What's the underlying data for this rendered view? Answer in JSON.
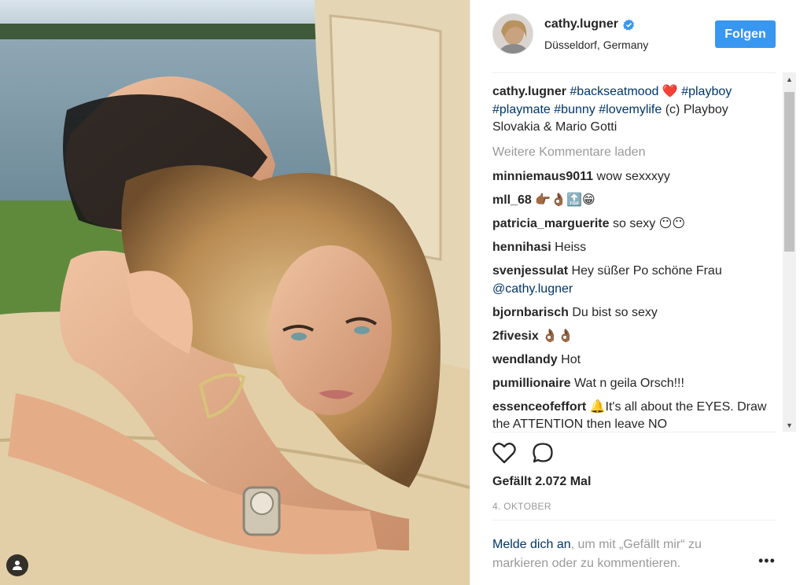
{
  "post": {
    "username": "cathy.lugner",
    "location": "Düsseldorf, Germany",
    "follow_label": "Folgen",
    "caption": {
      "user": "cathy.lugner",
      "tag1": "#backseatmood",
      "heart": "❤️",
      "tag2": "#playboy",
      "tag3": "#playmate",
      "tag4": "#bunny",
      "tag5": "#lovemylife",
      "rest": " (c) Playboy Slovakia & Mario Gotti"
    },
    "load_more": "Weitere Kommentare laden",
    "comments": [
      {
        "user": "minniemaus9011",
        "text": "wow sexxxyy"
      },
      {
        "user": "mll_68",
        "text": "👉🏾👌🏾🔝😁"
      },
      {
        "user": "patricia_marguerite",
        "text": "so sexy 😶😶"
      },
      {
        "user": "hennihasi",
        "text": "Heiss"
      },
      {
        "user": "svenjessulat",
        "text": "Hey süßer Po schöne Frau",
        "mention": "@cathy.lugner"
      },
      {
        "user": "bjornbarisch",
        "text": "Du bist so sexy"
      },
      {
        "user": "2fivesix",
        "text": "👌🏾👌🏾"
      },
      {
        "user": "wendlandy",
        "text": "Hot"
      },
      {
        "user": "pumillionaire",
        "text": "Wat n geila Orsch!!!"
      },
      {
        "user": "essenceofeffort",
        "text": "🔔It's all about the EYES. Draw the ATTENTION then leave NO"
      }
    ],
    "likes": "Gefällt 2.072 Mal",
    "date": "4. OKTOBER",
    "login_link": "Melde dich an",
    "login_rest": ", um mit „Gefällt mir“ zu markieren oder zu kommentieren.",
    "more_label": "•••"
  },
  "icons": {
    "verified": "verified-badge-icon",
    "like": "heart-outline-icon",
    "comment": "speech-bubble-icon",
    "tag_user": "user-tag-icon"
  },
  "colors": {
    "accent": "#3897f0",
    "link": "#003569",
    "muted": "#999999"
  }
}
